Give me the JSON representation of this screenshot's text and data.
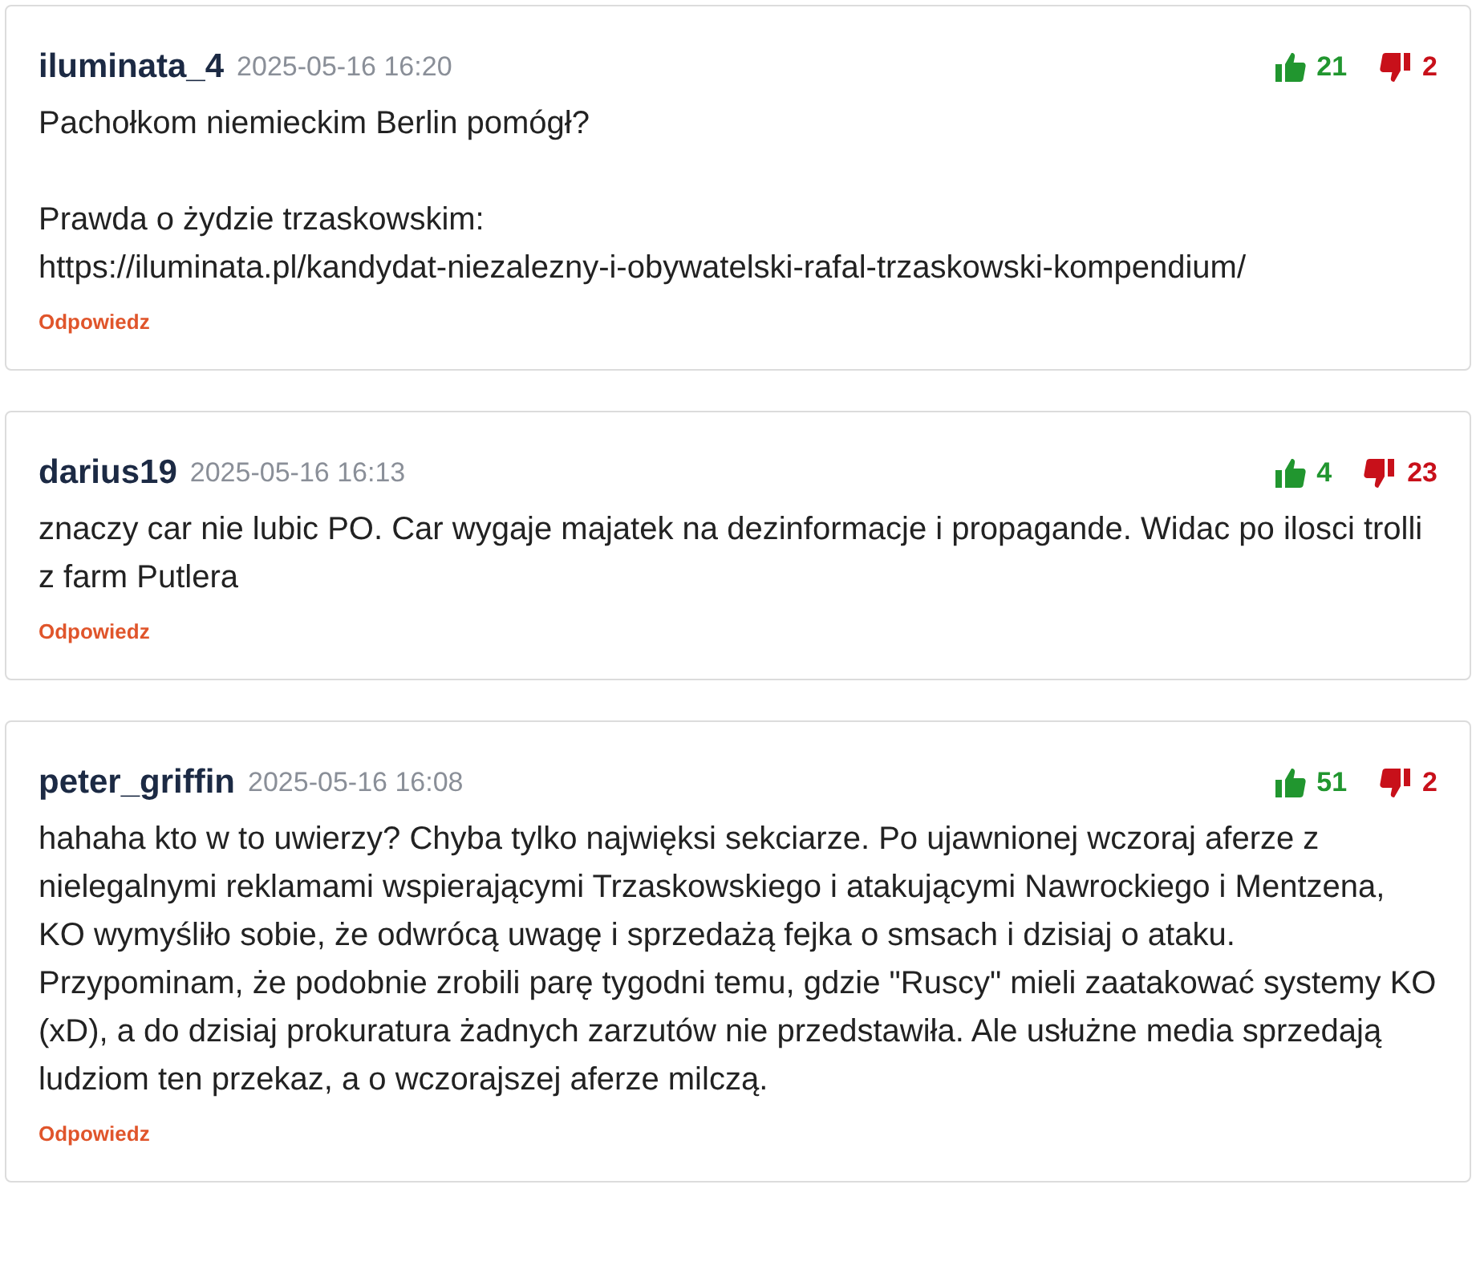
{
  "comments": [
    {
      "author": "iluminata_4",
      "date": "2025-05-16 16:20",
      "likes": "21",
      "dislikes": "2",
      "paragraphs": [
        "Pachołkom niemieckim Berlin pomógł?",
        "Prawda o żydzie trzaskowskim:\nhttps://iluminata.pl/kandydat-niezalezny-i-obywatelski-rafal-trzaskowski-kompendium/"
      ],
      "reply": "Odpowiedz"
    },
    {
      "author": "darius19",
      "date": "2025-05-16 16:13",
      "likes": "4",
      "dislikes": "23",
      "paragraphs": [
        "znaczy car nie lubic PO. Car wygaje majatek na dezinformacje i propagande. Widac po ilosci trolli z farm Putlera"
      ],
      "reply": "Odpowiedz"
    },
    {
      "author": "peter_griffin",
      "date": "2025-05-16 16:08",
      "likes": "51",
      "dislikes": "2",
      "paragraphs": [
        "hahaha kto w to uwierzy? Chyba tylko najwięksi sekciarze. Po ujawnionej wczoraj aferze z nielegalnymi reklamami wspierającymi Trzaskowskiego i atakującymi Nawrockiego i Mentzena, KO wymyśliło sobie, że odwrócą uwagę i sprzedażą fejka o smsach i dzisiaj o ataku. Przypominam, że podobnie zrobili parę tygodni temu, gdzie \"Ruscy\" mieli zaatakować systemy KO (xD), a do dzisiaj prokuratura żadnych zarzutów nie przedstawiła. Ale usłużne media sprzedają ludziom ten przekaz, a o wczorajszej aferze milczą."
      ],
      "reply": "Odpowiedz"
    }
  ]
}
